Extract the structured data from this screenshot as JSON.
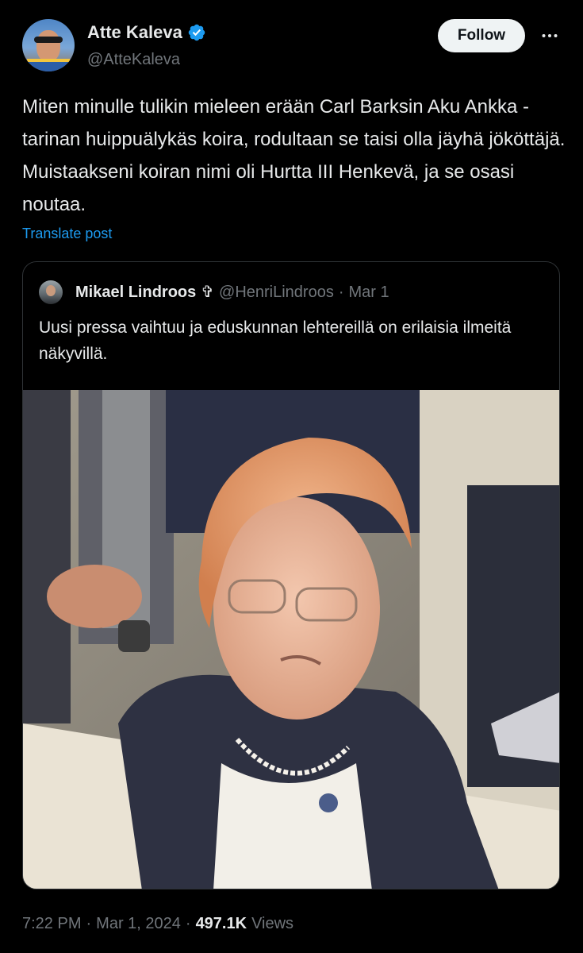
{
  "author": {
    "display_name": "Atte Kaleva",
    "handle": "@AtteKaleva",
    "verified_icon": "verified-badge-icon",
    "verified_color": "#1d9bf0"
  },
  "actions": {
    "follow_label": "Follow",
    "more_icon": "more-options-icon"
  },
  "tweet": {
    "text": "Miten minulle tulikin mieleen erään Carl Barksin Aku Ankka -tarinan huippuälykäs koira, rodultaan se taisi olla jäyhä jököttäjä. Muistaakseni koiran nimi oli Hurtta III Henkevä, ja se osasi noutaa.",
    "translate_label": "Translate post"
  },
  "quoted": {
    "display_name": "Mikael Lindroos",
    "badge_glyph": "✞",
    "handle": "@HenriLindroos",
    "separator": "·",
    "date": "Mar 1",
    "text": "Uusi pressa vaihtuu ja eduskunnan lehtereillä on erilaisia ilmeitä näkyvillä."
  },
  "footer": {
    "time": "7:22 PM",
    "separator": "·",
    "date": "Mar 1, 2024",
    "views_count": "497.1K",
    "views_label": "Views"
  },
  "colors": {
    "background": "#000000",
    "text_primary": "#e7e9ea",
    "text_secondary": "#71767b",
    "link": "#1d9bf0",
    "border": "#2f3336"
  }
}
